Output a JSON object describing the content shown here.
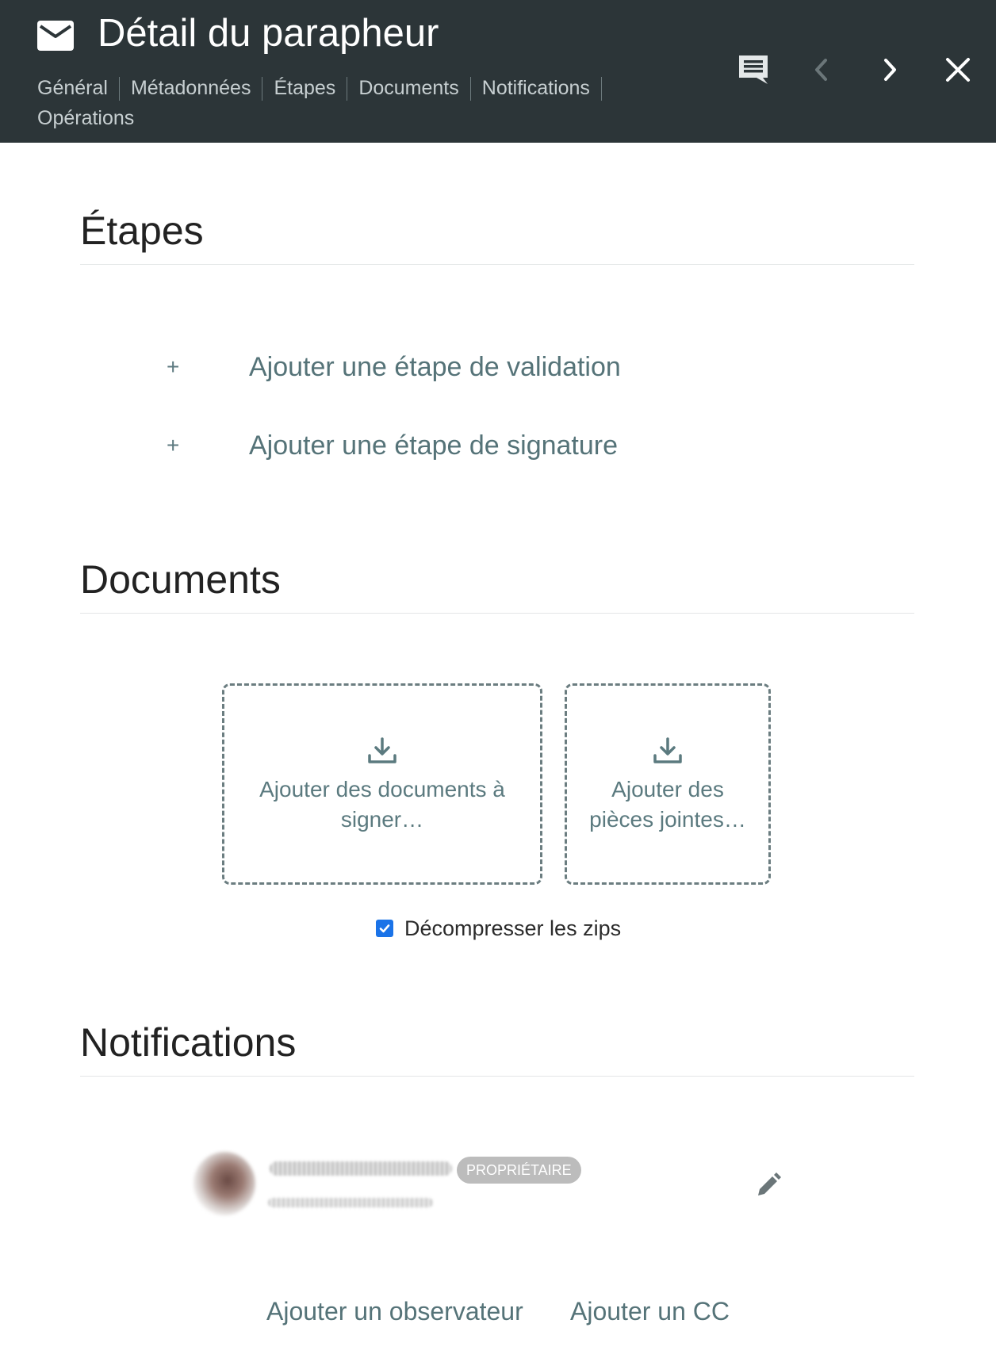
{
  "header": {
    "icon": "mail-icon",
    "title": "Détail du parapheur",
    "nav": [
      {
        "label": "Général"
      },
      {
        "label": "Métadonnées"
      },
      {
        "label": "Étapes"
      },
      {
        "label": "Documents"
      },
      {
        "label": "Notifications"
      },
      {
        "label": "Opérations"
      }
    ],
    "actions": [
      "comment-icon",
      "chevron-left-icon",
      "chevron-right-icon",
      "close-icon"
    ]
  },
  "etapes": {
    "title": "Étapes",
    "add_validation": "Ajouter une étape de validation",
    "add_signature": "Ajouter une étape de signature",
    "plus": "+"
  },
  "documents": {
    "title": "Documents",
    "dropzone_docs": {
      "line1": "Ajouter des documents à",
      "line2": "signer…"
    },
    "dropzone_attachments": {
      "line1": "Ajouter des",
      "line2": "pièces jointes…"
    },
    "unzip": {
      "label": "Décompresser les zips",
      "checked": true
    }
  },
  "notifications": {
    "title": "Notifications",
    "owner_badge": "PROPRIÉTAIRE",
    "add_observer": "Ajouter un observateur",
    "add_cc": "Ajouter un CC"
  },
  "colors": {
    "header_bg": "#2c3538",
    "link": "#557378",
    "checkbox": "#1a73e8"
  }
}
